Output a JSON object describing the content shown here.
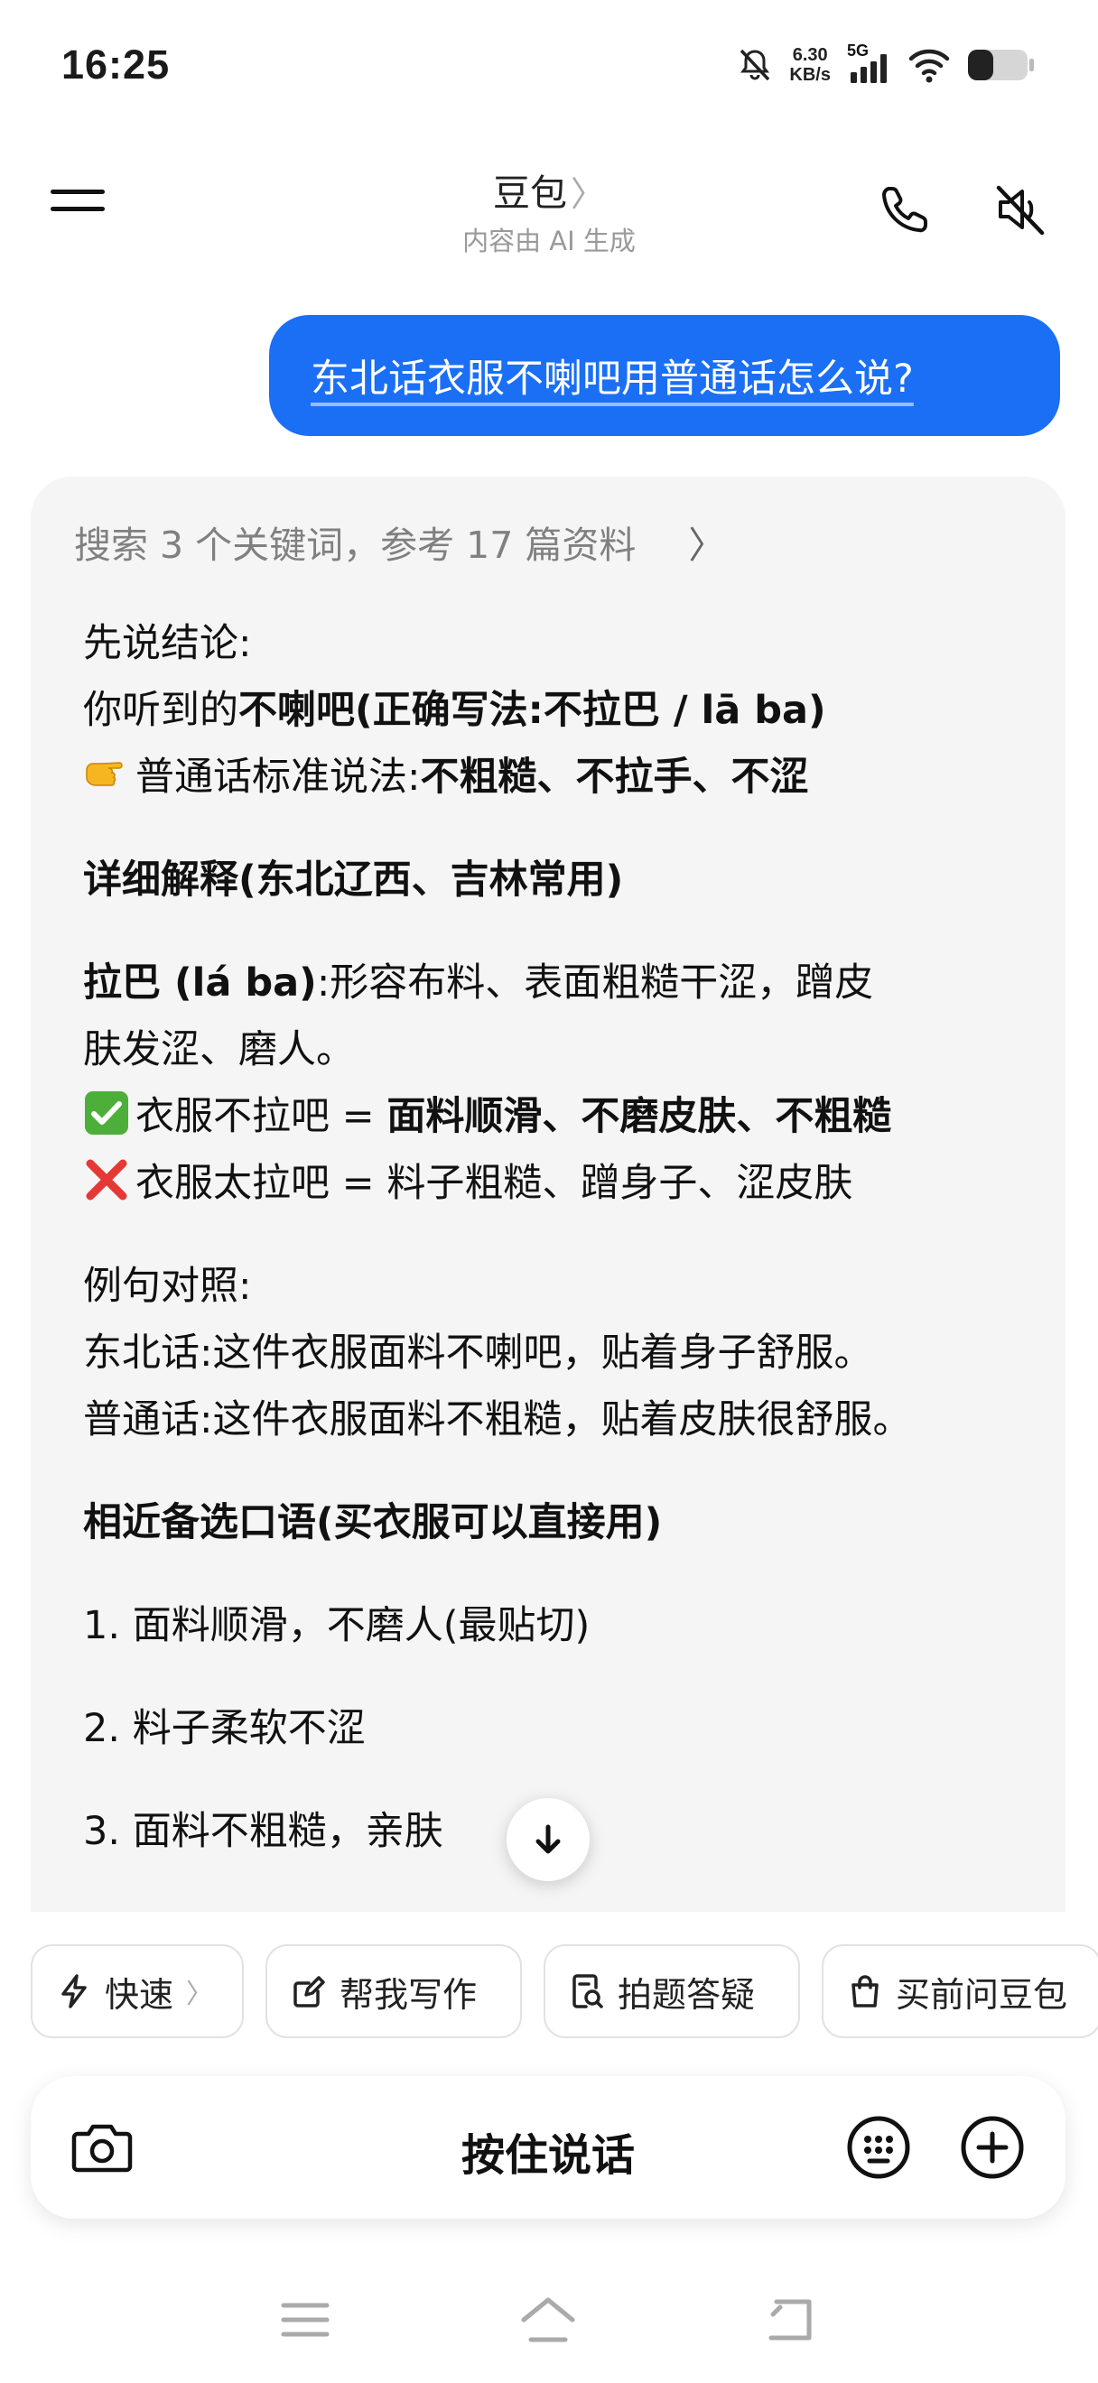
{
  "status_bar": {
    "time": "16:25",
    "net_speed_value": "6.30",
    "net_speed_unit": "KB/s",
    "network_type": "5G",
    "icons": [
      "mute-bell-icon",
      "signal-icon",
      "wifi-icon",
      "battery-icon"
    ]
  },
  "header": {
    "title": "豆包",
    "title_chevron": "〉",
    "subtitle": "内容由 AI 生成",
    "icons": [
      "menu-icon",
      "phone-icon",
      "speaker-mute-icon"
    ]
  },
  "user_message": "东北话衣服不喇吧用普通话怎么说?",
  "answer": {
    "search_summary": "搜索 3 个关键词，参考 17 篇资料",
    "search_chevron": "〉",
    "conclusion_label": "先说结论:",
    "line1_prefix": "你听到的",
    "line1_bold": "不喇吧(正确写法:不拉巴 / lā ba)",
    "line2_prefix": "普通话标准说法:",
    "line2_bold": "不粗糙、不拉手、不涩",
    "heading_explain": "详细解释(东北辽西、吉林常用)",
    "laba_term": "拉巴 (lá ba)",
    "laba_def_line1": ":形容布料、表面粗糙干涩，蹭皮",
    "laba_def_line2": "肤发涩、磨人。",
    "good_prefix": "衣服不拉吧 = ",
    "good_bold": "面料顺滑、不磨皮肤、不粗糙",
    "bad_text": "衣服太拉吧 = 料子粗糙、蹭身子、涩皮肤",
    "example_label": "例句对照:",
    "example_ne": "东北话:这件衣服面料不喇吧，贴着身子舒服。",
    "example_pt": "普通话:这件衣服面料不粗糙，贴着皮肤很舒服。",
    "heading_alt": "相近备选口语(买衣服可以直接用)",
    "alt_items": [
      "1. 面料顺滑，不磨人(最贴切)",
      "2. 料子柔软不涩",
      "3. 面料不粗糙，亲肤"
    ],
    "emojis": [
      "point-right-emoji",
      "check-mark-emoji",
      "cross-mark-emoji"
    ]
  },
  "scroll_down_icon": "arrow-down-icon",
  "chips": [
    {
      "label": "快速",
      "icon": "lightning-icon",
      "chevron": "〉"
    },
    {
      "label": "帮我写作",
      "icon": "edit-icon"
    },
    {
      "label": "拍题答疑",
      "icon": "scan-question-icon"
    },
    {
      "label": "买前问豆包",
      "icon": "shopping-bag-icon"
    }
  ],
  "input_bar": {
    "hold_to_talk": "按住说话",
    "icons": [
      "camera-icon",
      "emoji-keyboard-icon",
      "plus-icon"
    ]
  },
  "system_nav": [
    "menu-nav-icon",
    "home-icon",
    "back-icon"
  ],
  "colors": {
    "accent_blue": "#1a6ff5",
    "card_bg": "#f5f5f5",
    "muted_text": "#808080"
  }
}
